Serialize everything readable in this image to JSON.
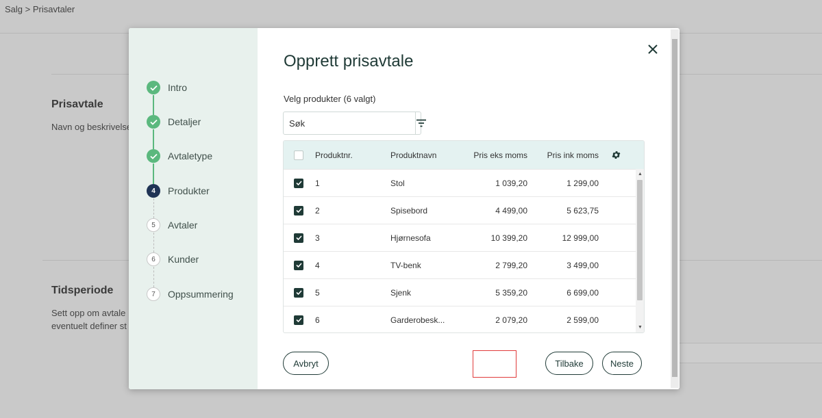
{
  "breadcrumb": "Salg > Prisavtaler",
  "background": {
    "section1_title": "Prisavtale",
    "section1_desc": "Navn og beskrivelse",
    "section2_title": "Tidsperiode",
    "section2_desc_line1": "Sett opp om avtale",
    "section2_desc_line2": "eventuelt definer st"
  },
  "modal": {
    "title": "Opprett prisavtale",
    "subtitle": "Velg produkter (6 valgt)",
    "search_placeholder": "Søk",
    "steps": [
      {
        "number": "1",
        "label": "Intro",
        "status": "done"
      },
      {
        "number": "2",
        "label": "Detaljer",
        "status": "done"
      },
      {
        "number": "3",
        "label": "Avtaletype",
        "status": "done"
      },
      {
        "number": "4",
        "label": "Produkter",
        "status": "current"
      },
      {
        "number": "5",
        "label": "Avtaler",
        "status": "todo"
      },
      {
        "number": "6",
        "label": "Kunder",
        "status": "todo"
      },
      {
        "number": "7",
        "label": "Oppsummering",
        "status": "todo"
      }
    ],
    "table": {
      "headers": {
        "nr": "Produktnr.",
        "name": "Produktnavn",
        "eks": "Pris eks moms",
        "ink": "Pris ink moms"
      },
      "rows": [
        {
          "checked": true,
          "nr": "1",
          "name": "Stol",
          "eks": "1 039,20",
          "ink": "1 299,00"
        },
        {
          "checked": true,
          "nr": "2",
          "name": "Spisebord",
          "eks": "4 499,00",
          "ink": "5 623,75"
        },
        {
          "checked": true,
          "nr": "3",
          "name": "Hjørnesofa",
          "eks": "10 399,20",
          "ink": "12 999,00"
        },
        {
          "checked": true,
          "nr": "4",
          "name": "TV-benk",
          "eks": "2 799,20",
          "ink": "3 499,00"
        },
        {
          "checked": true,
          "nr": "5",
          "name": "Sjenk",
          "eks": "5 359,20",
          "ink": "6 699,00"
        },
        {
          "checked": true,
          "nr": "6",
          "name": "Garderobesk...",
          "eks": "2 079,20",
          "ink": "2 599,00"
        }
      ]
    },
    "buttons": {
      "cancel": "Avbryt",
      "back": "Tilbake",
      "next": "Neste"
    }
  },
  "colors": {
    "accent_dark": "#1f3a36",
    "step_done": "#5bb87e",
    "step_current": "#1f3355",
    "highlight": "#e03a3a"
  }
}
